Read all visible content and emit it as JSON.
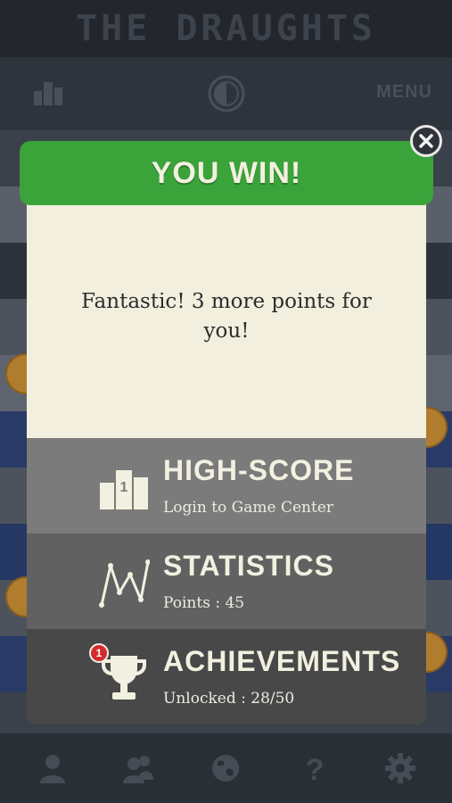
{
  "app": {
    "title": "THE DRAUGHTS"
  },
  "top_bar": {
    "menu_label": "MENU",
    "left_icon": "podium-icon",
    "center_icon": "half-circle-icon"
  },
  "modal": {
    "title": "YOU WIN!",
    "message": "Fantastic! 3 more points for you!",
    "close_icon": "close-icon",
    "actions": [
      {
        "label": "HIGH-SCORE",
        "sub": "Login to Game Center",
        "icon": "podium-icon"
      },
      {
        "label": "STATISTICS",
        "sub": "Points : 45",
        "icon": "line-chart-icon"
      },
      {
        "label": "ACHIEVEMENTS",
        "sub": "Unlocked : 28/50",
        "icon": "trophy-icon",
        "badge": "1"
      }
    ]
  },
  "bottom_nav": [
    {
      "icon": "user-icon"
    },
    {
      "icon": "users-icon"
    },
    {
      "icon": "globe-icon"
    },
    {
      "icon": "help-icon"
    },
    {
      "icon": "gear-icon"
    }
  ],
  "colors": {
    "header_green": "#3aa33a",
    "body_cream": "#f2efdf",
    "highscore_bg": "#7b7b7b",
    "statistics_bg": "#616161",
    "achievements_bg": "#484848",
    "badge_red": "#d42c2c"
  }
}
